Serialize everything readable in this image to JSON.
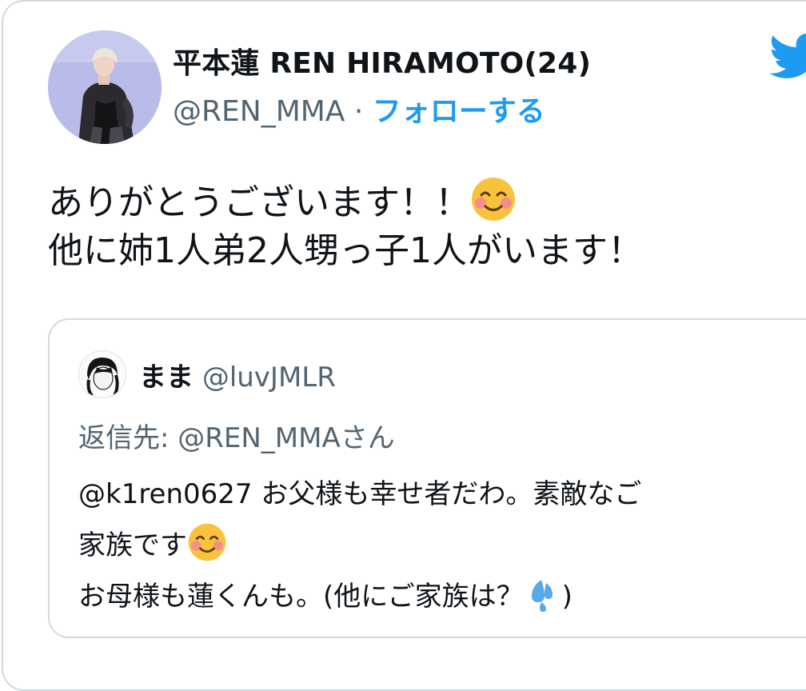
{
  "tweet": {
    "author": {
      "display_name": "平本蓮 REN HIRAMOTO(24)",
      "handle": "@REN_MMA",
      "separator": "·",
      "follow_label": "フォローする"
    },
    "text_lines": [
      "ありがとうございます！！",
      "他に姉1人弟2人甥っ子1人がいます！"
    ],
    "emoji": "smiling-face-with-smiling-eyes"
  },
  "quoted_tweet": {
    "display_name": "まま",
    "handle": "@luvJMLR",
    "reply_to": "返信先: @REN_MMAさん",
    "text_lines": [
      "@k1ren0627 お父様も幸せ者だわ。素敵なご",
      "家族です",
      "お母様も蓮くんも。(他にご家族は？",
      ")"
    ],
    "emoji": [
      "smiling-face-with-smiling-eyes",
      "sweat-droplets"
    ]
  },
  "colors": {
    "accent": "#1d9bf0",
    "secondary_text": "#536471",
    "border": "#cfd9de"
  }
}
